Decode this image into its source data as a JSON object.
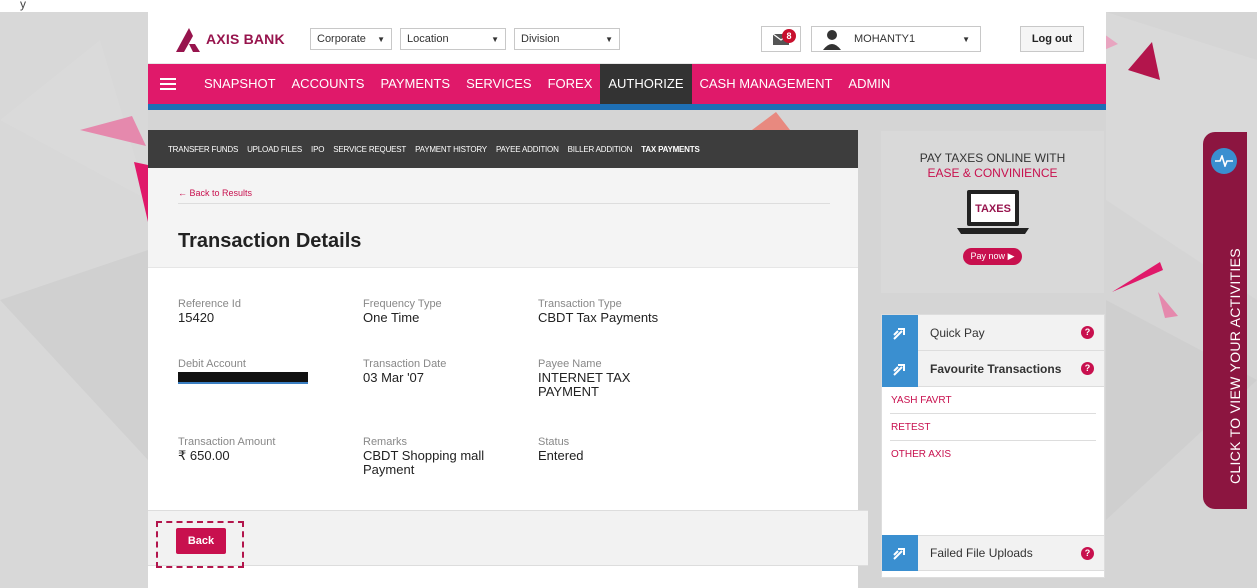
{
  "page_title": "Transaction Details",
  "brand": {
    "name": "AXIS BANK",
    "color": "#97144d"
  },
  "top_note": "y",
  "header": {
    "selects": [
      "Corporate",
      "Location",
      "Division"
    ],
    "mail_badge": "8",
    "user": "MOHANTY1",
    "logout": "Log out"
  },
  "nav": {
    "items": [
      "SNAPSHOT",
      "ACCOUNTS",
      "PAYMENTS",
      "SERVICES",
      "FOREX",
      "AUTHORIZE",
      "CASH MANAGEMENT",
      "ADMIN"
    ],
    "active": "AUTHORIZE"
  },
  "subnav": {
    "items": [
      "TRANSFER FUNDS",
      "UPLOAD FILES",
      "IPO",
      "SERVICE REQUEST",
      "PAYMENT HISTORY",
      "PAYEE ADDITION",
      "BILLER ADDITION",
      "TAX PAYMENTS"
    ],
    "active": "TAX PAYMENTS"
  },
  "details": {
    "back_link": "← Back to Results",
    "reference_id": {
      "label": "Reference Id",
      "value": "15420"
    },
    "frequency_type": {
      "label": "Frequency Type",
      "value": "One Time"
    },
    "transaction_type": {
      "label": "Transaction Type",
      "value": "CBDT Tax Payments"
    },
    "debit_account": {
      "label": "Debit Account",
      "value": ""
    },
    "transaction_date": {
      "label": "Transaction Date",
      "value": "03 Mar '07"
    },
    "payee_name": {
      "label": "Payee Name",
      "value_line1": "INTERNET TAX",
      "value_line2": "PAYMENT"
    },
    "transaction_amount": {
      "label": "Transaction Amount",
      "value": "₹ 650.00"
    },
    "remarks": {
      "label": "Remarks",
      "value_line1": "CBDT Shopping mall",
      "value_line2": "Payment"
    },
    "status": {
      "label": "Status",
      "value": "Entered"
    },
    "back_button": "Back"
  },
  "promo": {
    "line1": "PAY TAXES ONLINE WITH",
    "line2": "EASE & CONVINIENCE",
    "screen_text": "TAXES",
    "cta": "Pay now"
  },
  "quick": {
    "quick_pay": "Quick Pay",
    "favourites": "Favourite Transactions",
    "favourite_items": [
      "YASH FAVRT",
      "RETEST",
      "OTHER AXIS"
    ],
    "failed_uploads": "Failed File Uploads",
    "help": "?"
  },
  "activity_tab": "CLICK TO VIEW YOUR ACTIVITIES",
  "colors": {
    "primary": "#e0196a",
    "accent_blue": "#1e6fb5",
    "dark_nav": "#3d3d3d"
  }
}
